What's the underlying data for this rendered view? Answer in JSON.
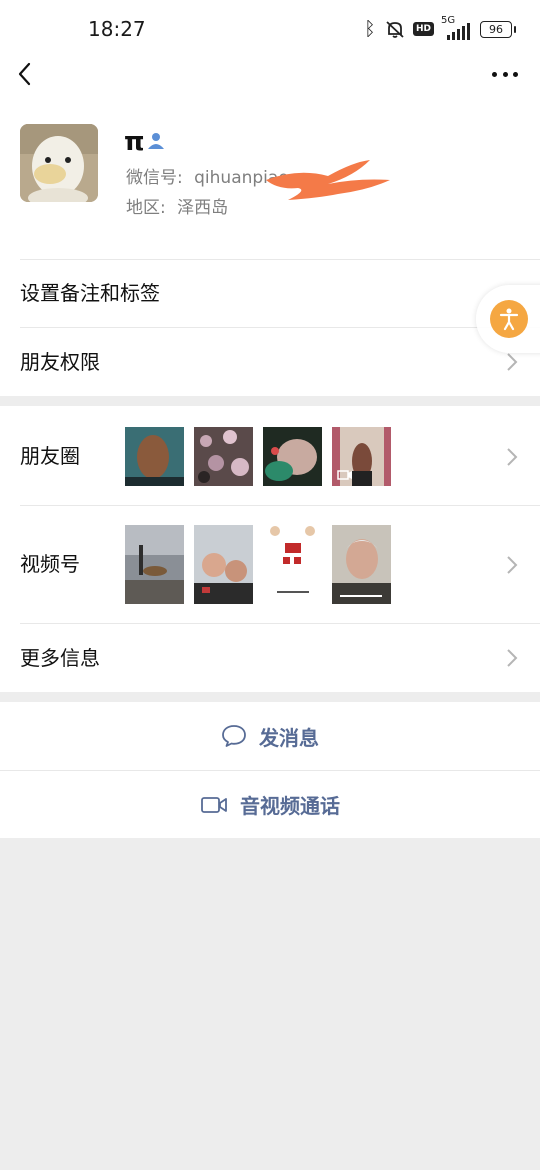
{
  "status_bar": {
    "time": "18:27",
    "network": "5G",
    "hd": "HD",
    "battery": "96",
    "icons": [
      "bluetooth-icon",
      "mute-bell-icon",
      "hd-icon",
      "signal-icon",
      "battery-icon"
    ]
  },
  "nav": {
    "back_icon": "back-arrow-icon",
    "more_icon": "more-dots-icon"
  },
  "profile": {
    "name": "π",
    "wechat_id_label": "微信号:",
    "wechat_id_value": "qihuanpiao",
    "region_label": "地区:",
    "region_value": "泽西岛"
  },
  "rows": {
    "remark": "设置备注和标签",
    "permissions": "朋友权限",
    "moments": "朋友圈",
    "channels": "视频号",
    "more_info": "更多信息"
  },
  "actions": {
    "message": "发消息",
    "call": "音视频通话"
  },
  "colors": {
    "link_blue": "#576b95",
    "accent_orange": "#f5a742",
    "redaction": "#f47a48",
    "background_gray": "#ededed"
  }
}
